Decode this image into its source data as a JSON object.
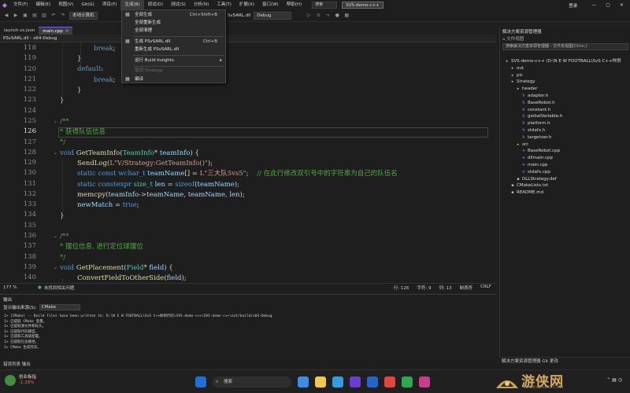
{
  "menubar": {
    "items": [
      "文件(F)",
      "编辑(E)",
      "视图(V)",
      "Git(G)",
      "项目(P)",
      "生成(B)",
      "调试(D)",
      "测试(S)",
      "分析(N)",
      "工具(T)",
      "扩展(X)",
      "窗口(W)",
      "帮助(H)"
    ],
    "search": "搜索",
    "project": "SVS-demo-c++",
    "login": "登录"
  },
  "toolbar": {
    "config": "本地计算机",
    "target": "SvSARL.dll",
    "build_mode": "Debug"
  },
  "dropdown": {
    "items": [
      {
        "label": "全部生成",
        "shortcut": "Ctrl+Shift+B",
        "icon": "build-icon"
      },
      {
        "label": "全部重新生成",
        "shortcut": ""
      },
      {
        "label": "全部清理",
        "shortcut": ""
      },
      {
        "label": "生成 PSvSARL.dll",
        "shortcut": "Ctrl+B",
        "icon": "build-icon"
      },
      {
        "label": "重新生成 PSvSARL.dll",
        "shortcut": ""
      },
      {
        "label": "运行 Build Insights",
        "shortcut": ""
      },
      {
        "label": "取消 Strategy",
        "shortcut": ""
      },
      {
        "label": "编译",
        "shortcut": ""
      }
    ]
  },
  "tabs": {
    "items": [
      {
        "label": "launch.vs.json"
      },
      {
        "label": "main.cpp"
      }
    ],
    "nav": "PSvSARL.dll - x64-Debug"
  },
  "editor": {
    "current_line": "126",
    "lines": [
      {
        "num": "118"
      },
      {
        "num": "119"
      },
      {
        "num": "120"
      },
      {
        "num": "121"
      },
      {
        "num": "122"
      },
      {
        "num": "123"
      },
      {
        "num": "124"
      },
      {
        "num": "125"
      },
      {
        "num": "126"
      },
      {
        "num": "127"
      },
      {
        "num": "128"
      },
      {
        "num": "129"
      },
      {
        "num": "130"
      },
      {
        "num": "131"
      },
      {
        "num": "132"
      },
      {
        "num": "133"
      },
      {
        "num": "134"
      },
      {
        "num": "135"
      },
      {
        "num": "136"
      },
      {
        "num": "137"
      },
      {
        "num": "138"
      },
      {
        "num": "139"
      },
      {
        "num": "140"
      }
    ]
  },
  "editor_status": {
    "zoom": "177 %",
    "issues": "未找到相关问题",
    "line": "行: 126",
    "char": "字符: 9",
    "col": "列: 13",
    "mode": "制表符",
    "eol": "CRLF"
  },
  "output": {
    "title": "输出",
    "source_label": "显示输出来源(S):",
    "source": "CMake",
    "lines": [
      "1> [CMake] -- Build files have been written to: D:\\N E W FOOTBALL\\SvS C++样例代码\\SVS-demo-c++\\SVS-demo-c++\\out/build/x64-Debug",
      "1> 已提取 CMake 变量。",
      "1> 已提取源文件和标头。",
      "1> 已提取代码模型。",
      "1> 已提取工具链配置。",
      "1> 已提取包含路径。",
      "1> CMake 生成完毕。"
    ],
    "bottom_tabs": "错误列表   输出"
  },
  "solution": {
    "title": "解决方案资源管理器",
    "tools_label": "文件视图",
    "search_placeholder": "搜索解决方案资源管理器 - 文件夹视图(Ctrl+;)",
    "tree": [
      {
        "label": "SVS-demo-c++ (D:\\N E W FOOTBALL\\SvS C++样例",
        "kind": "folder"
      },
      {
        "label": "out",
        "kind": "folder"
      },
      {
        "label": "pic",
        "kind": "folder"
      },
      {
        "label": "Strategy",
        "kind": "folder"
      },
      {
        "label": "header",
        "kind": "folder"
      },
      {
        "label": "adapter.h",
        "kind": "hdr"
      },
      {
        "label": "BaseRobot.h",
        "kind": "hdr"
      },
      {
        "label": "constant.h",
        "kind": "hdr"
      },
      {
        "label": "globalVariable.h",
        "kind": "hdr"
      },
      {
        "label": "platform.h",
        "kind": "hdr"
      },
      {
        "label": "stdafx.h",
        "kind": "hdr"
      },
      {
        "label": "targetver.h",
        "kind": "hdr"
      },
      {
        "label": "src",
        "kind": "folder"
      },
      {
        "label": "BaseRobot.cpp",
        "kind": "cpp"
      },
      {
        "label": "dllmain.cpp",
        "kind": "cpp"
      },
      {
        "label": "main.cpp",
        "kind": "cpp"
      },
      {
        "label": "stdafx.cpp",
        "kind": "cpp"
      },
      {
        "label": "DLLStrategy.def",
        "kind": "gen"
      },
      {
        "label": "CMakeLists.txt",
        "kind": "gen"
      },
      {
        "label": "README.md",
        "kind": "gen"
      }
    ],
    "bottom": "解决方案资源管理器   Git 更改"
  },
  "taskbar": {
    "weather_title": "创业板指",
    "weather_value": "-1.28%",
    "search": "搜索"
  },
  "watermark": {
    "title": "游侠网",
    "subtitle": "YOUXIGAME.COM"
  },
  "colors": {
    "accent": "#7160e8",
    "keyword": "#569cd6",
    "comment": "#57a64a",
    "string": "#d69d85",
    "function": "#dcdcaa"
  }
}
